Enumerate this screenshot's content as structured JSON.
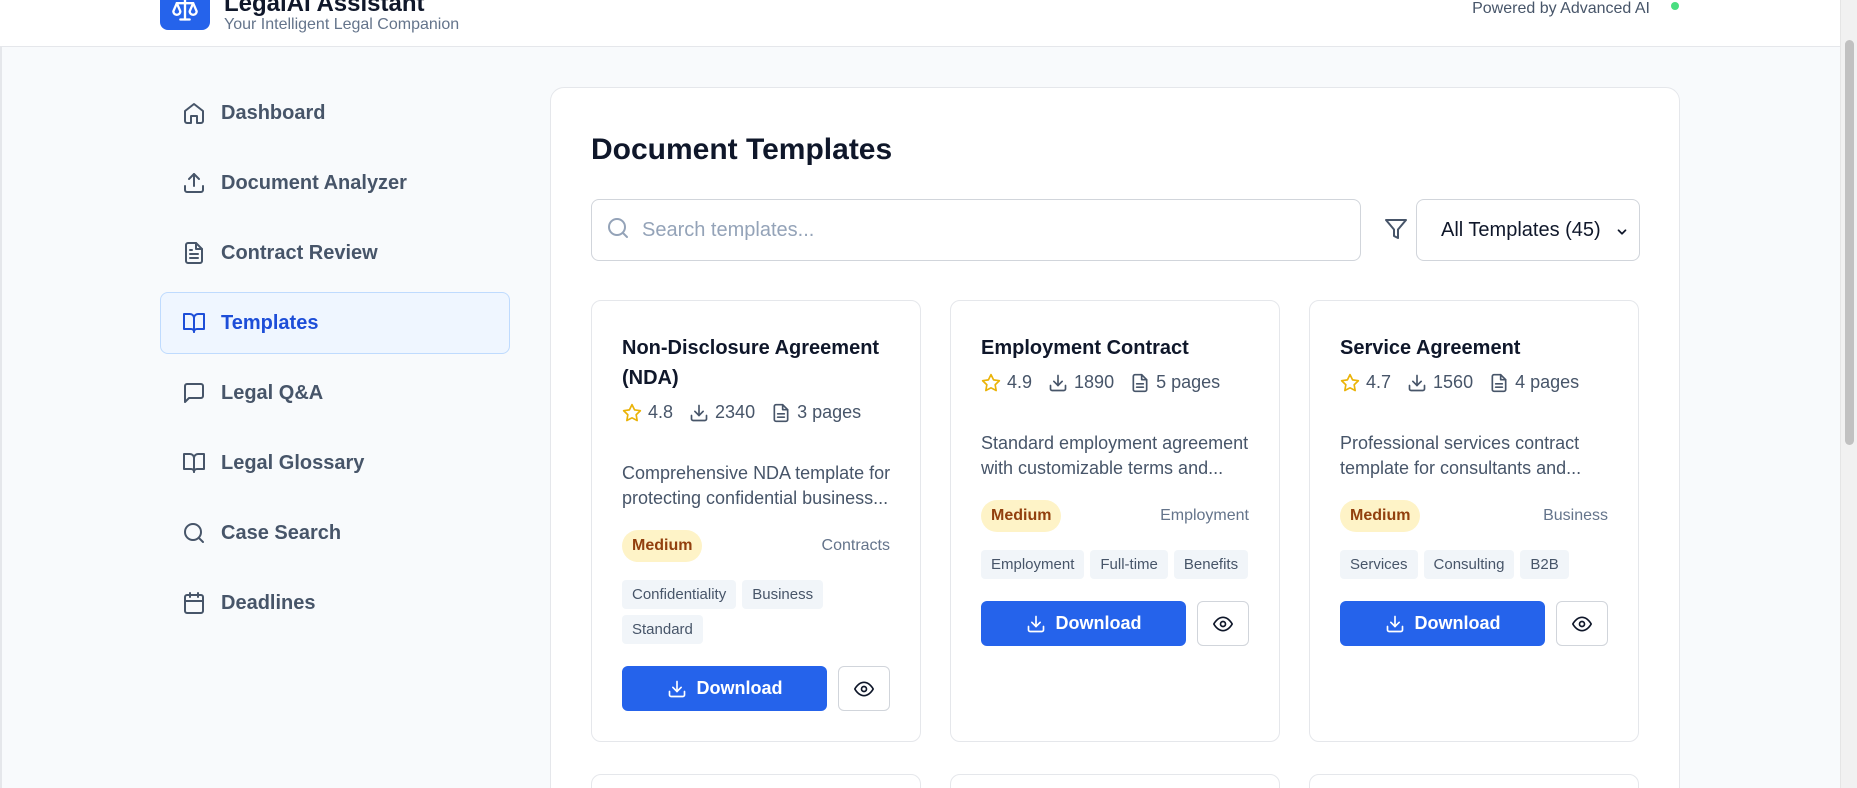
{
  "header": {
    "title": "LegalAI Assistant",
    "subtitle": "Your Intelligent Legal Companion",
    "powered_by": "Powered by Advanced AI",
    "status_color": "#4ade80"
  },
  "sidebar": {
    "items": [
      {
        "label": "Dashboard",
        "icon": "home-icon",
        "active": false
      },
      {
        "label": "Document Analyzer",
        "icon": "upload-icon",
        "active": false
      },
      {
        "label": "Contract Review",
        "icon": "file-text-icon",
        "active": false
      },
      {
        "label": "Templates",
        "icon": "book-open-icon",
        "active": true
      },
      {
        "label": "Legal Q&A",
        "icon": "message-square-icon",
        "active": false
      },
      {
        "label": "Legal Glossary",
        "icon": "book-open-icon",
        "active": false
      },
      {
        "label": "Case Search",
        "icon": "search-icon",
        "active": false
      },
      {
        "label": "Deadlines",
        "icon": "calendar-icon",
        "active": false
      }
    ]
  },
  "main": {
    "title": "Document Templates",
    "search_placeholder": "Search templates...",
    "filter_selected": "All Templates (45)",
    "download_label": "Download",
    "cards": [
      {
        "title": "Non-Disclosure Agreement (NDA)",
        "rating": "4.8",
        "downloads": "2340",
        "pages": "3 pages",
        "description": "Comprehensive NDA template for protecting confidential business...",
        "difficulty": "Medium",
        "category": "Contracts",
        "tags": [
          "Confidentiality",
          "Business",
          "Standard"
        ]
      },
      {
        "title": "Employment Contract",
        "rating": "4.9",
        "downloads": "1890",
        "pages": "5 pages",
        "description": "Standard employment agreement with customizable terms and...",
        "difficulty": "Medium",
        "category": "Employment",
        "tags": [
          "Employment",
          "Full-time",
          "Benefits"
        ]
      },
      {
        "title": "Service Agreement",
        "rating": "4.7",
        "downloads": "1560",
        "pages": "4 pages",
        "description": "Professional services contract template for consultants and...",
        "difficulty": "Medium",
        "category": "Business",
        "tags": [
          "Services",
          "Consulting",
          "B2B"
        ]
      }
    ]
  },
  "colors": {
    "accent": "#2563eb",
    "active_bg": "#eff6ff",
    "badge_bg": "#fef3c7",
    "badge_text": "#92400e",
    "star": "#eab308"
  }
}
